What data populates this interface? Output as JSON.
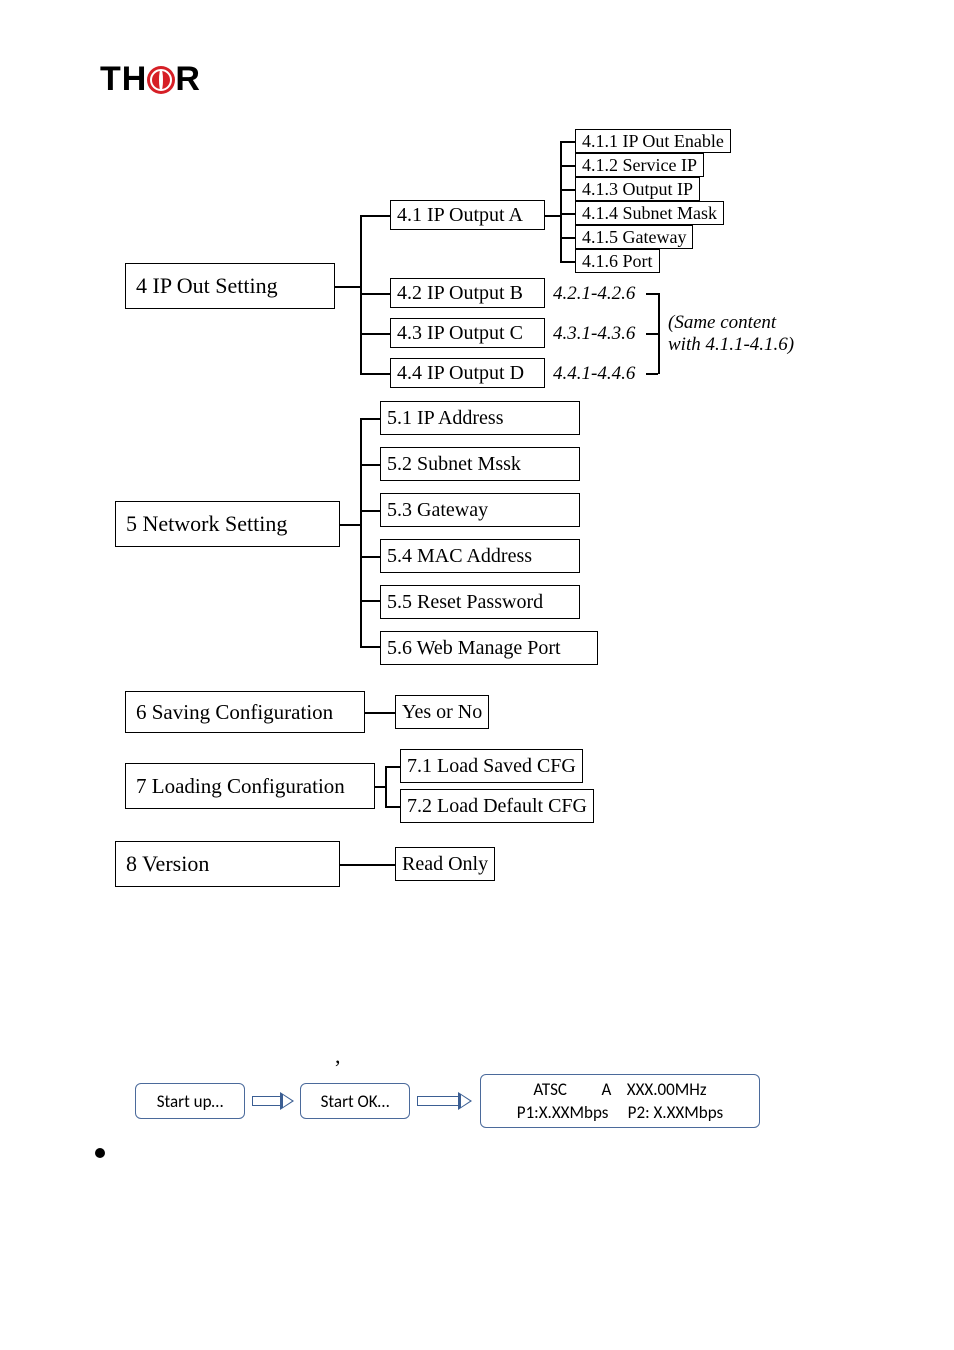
{
  "logo": {
    "pre": "TH",
    "post": "R"
  },
  "menu4": {
    "root": "4 IP Out Setting",
    "a": "4.1 IP Output A",
    "b": "4.2 IP Output B",
    "c": "4.3 IP Output C",
    "d": "4.4 IP Output D",
    "b_range": "4.2.1-4.2.6",
    "c_range": "4.3.1-4.3.6",
    "d_range": "4.4.1-4.4.6",
    "note1": "(Same content",
    "note2": "with 4.1.1-4.1.6)",
    "a1": "4.1.1 IP Out Enable",
    "a2": "4.1.2 Service IP",
    "a3": "4.1.3 Output IP",
    "a4": "4.1.4 Subnet Mask",
    "a5": "4.1.5 Gateway",
    "a6": "4.1.6 Port"
  },
  "menu5": {
    "root": "5 Network Setting",
    "i1": "5.1 IP Address",
    "i2": "5.2 Subnet Mssk",
    "i3": "5.3 Gateway",
    "i4": "5.4 MAC Address",
    "i5": "5.5 Reset Password",
    "i6": "5.6 Web Manage Port"
  },
  "menu6": {
    "root": "6 Saving Configuration",
    "opt": "Yes or No"
  },
  "menu7": {
    "root": "7 Loading Configuration",
    "i1": "7.1 Load Saved CFG",
    "i2": "7.2  Load Default CFG"
  },
  "menu8": {
    "root": "8 Version",
    "opt": "Read Only"
  },
  "flow": {
    "s1": "Start up…",
    "s2": "Start OK…",
    "final1": "ATSC         A    XXX.00MHz",
    "final2": "P1:X.XXMbps     P2: X.XXMbps"
  },
  "chart_data": {
    "type": "table",
    "title": "Device front-panel menu tree and boot-flow diagram",
    "menu_tree": [
      {
        "id": "4",
        "label": "IP Out Setting",
        "children": [
          {
            "id": "4.1",
            "label": "IP Output A",
            "children": [
              {
                "id": "4.1.1",
                "label": "IP Out Enable"
              },
              {
                "id": "4.1.2",
                "label": "Service IP"
              },
              {
                "id": "4.1.3",
                "label": "Output IP"
              },
              {
                "id": "4.1.4",
                "label": "Subnet Mask"
              },
              {
                "id": "4.1.5",
                "label": "Gateway"
              },
              {
                "id": "4.1.6",
                "label": "Port"
              }
            ]
          },
          {
            "id": "4.2",
            "label": "IP Output B",
            "children_same_as": "4.1",
            "range": "4.2.1-4.2.6"
          },
          {
            "id": "4.3",
            "label": "IP Output C",
            "children_same_as": "4.1",
            "range": "4.3.1-4.3.6"
          },
          {
            "id": "4.4",
            "label": "IP Output D",
            "children_same_as": "4.1",
            "range": "4.4.1-4.4.6"
          }
        ],
        "note": "(Same content with 4.1.1-4.1.6)"
      },
      {
        "id": "5",
        "label": "Network Setting",
        "children": [
          {
            "id": "5.1",
            "label": "IP Address"
          },
          {
            "id": "5.2",
            "label": "Subnet Mssk"
          },
          {
            "id": "5.3",
            "label": "Gateway"
          },
          {
            "id": "5.4",
            "label": "MAC Address"
          },
          {
            "id": "5.5",
            "label": "Reset Password"
          },
          {
            "id": "5.6",
            "label": "Web Manage Port"
          }
        ]
      },
      {
        "id": "6",
        "label": "Saving Configuration",
        "children": [
          {
            "label": "Yes or No"
          }
        ]
      },
      {
        "id": "7",
        "label": "Loading Configuration",
        "children": [
          {
            "id": "7.1",
            "label": "Load Saved CFG"
          },
          {
            "id": "7.2",
            "label": "Load Default CFG"
          }
        ]
      },
      {
        "id": "8",
        "label": "Version",
        "children": [
          {
            "label": "Read Only"
          }
        ]
      }
    ],
    "boot_flow": [
      "Start up…",
      "Start OK…",
      "ATSC  A  XXX.00MHz / P1:X.XXMbps  P2: X.XXMbps"
    ]
  }
}
